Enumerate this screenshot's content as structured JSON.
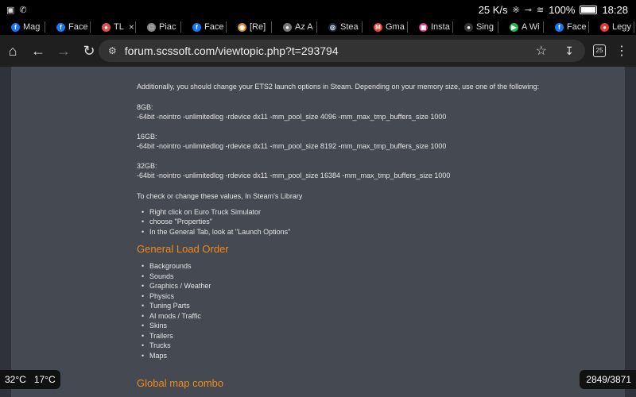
{
  "status": {
    "speed": "25 K/s",
    "battery": "100%",
    "time": "18:28"
  },
  "tabs": [
    {
      "label": "Mag",
      "icon": "facebook-icon",
      "color": "#1877f2"
    },
    {
      "label": "Face",
      "icon": "facebook-icon",
      "color": "#1877f2"
    },
    {
      "label": "TL",
      "icon": "site-icon",
      "color": "#d9534f",
      "closable": true
    },
    {
      "label": "Piac",
      "icon": "document-icon",
      "color": "#888888"
    },
    {
      "label": "Face",
      "icon": "facebook-icon",
      "color": "#1877f2"
    },
    {
      "label": "[Re]",
      "icon": "forum-icon",
      "color": "#c98a2b"
    },
    {
      "label": "Az A",
      "icon": "site-icon",
      "color": "#777777"
    },
    {
      "label": "Stea",
      "icon": "steam-icon",
      "color": "#1b2838"
    },
    {
      "label": "Gma",
      "icon": "gmail-icon",
      "color": "#ea4335"
    },
    {
      "label": "Insta",
      "icon": "instagram-icon",
      "color": "#c13584"
    },
    {
      "label": "Sing",
      "icon": "site-icon",
      "color": "#333333"
    },
    {
      "label": "A Wi",
      "icon": "play-icon",
      "color": "#2db34a"
    },
    {
      "label": "Face",
      "icon": "facebook-icon",
      "color": "#1877f2"
    },
    {
      "label": "Legy",
      "icon": "site-icon",
      "color": "#e53935"
    }
  ],
  "toolbar": {
    "url": "forum.scssoft.com/viewtopic.php?t=293794",
    "tab_count": "25"
  },
  "post": {
    "intro": "Additionally, you should change your ETS2 launch options in Steam. Depending on your memory size, use one of the following:",
    "options": [
      {
        "label": "8GB:",
        "value": "-64bit -nointro -unlimitedlog -rdevice dx11 -mm_pool_size 4096 -mm_max_tmp_buffers_size 1000"
      },
      {
        "label": "16GB:",
        "value": "-64bit -nointro -unlimitedlog -rdevice dx11 -mm_pool_size 8192 -mm_max_tmp_buffers_size 1000"
      },
      {
        "label": "32GB:",
        "value": "-64bit -nointro -unlimitedlog -rdevice dx11 -mm_pool_size 16384 -mm_max_tmp_buffers_size 1000"
      }
    ],
    "check_text": "To check or change these values, In Steam's Library",
    "steps": [
      "Right click on Euro Truck Simulator",
      "choose \"Properties\"",
      "In the General Tab, look at \"Launch Options\""
    ],
    "load_order_heading": "General Load Order",
    "load_order": [
      "Backgrounds",
      "Sounds",
      "Graphics / Weather",
      "Physics",
      "Tuning Parts",
      "AI mods / Traffic",
      "Skins",
      "Trailers",
      "Trucks",
      "Maps"
    ],
    "next_heading": "Global map combo"
  },
  "overlay": {
    "temp_high": "32°C",
    "temp_low": "17°C",
    "counter": "2849/3871"
  },
  "colors": {
    "heading": "#f08a1c",
    "content_bg": "#454a52",
    "side_bg": "#2f3339"
  }
}
